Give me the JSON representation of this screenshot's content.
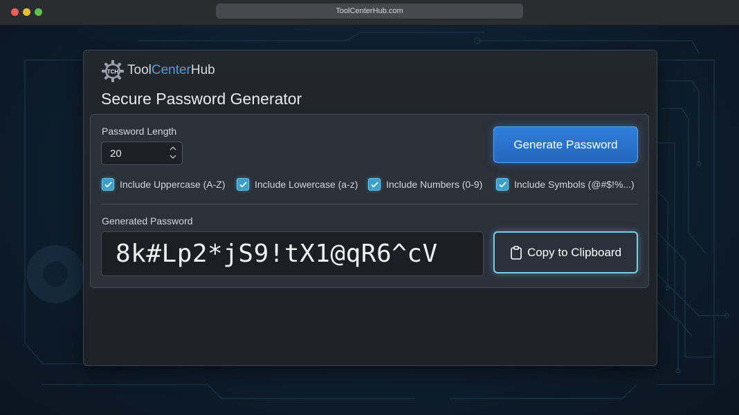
{
  "browser": {
    "url": "ToolCenterHub.com"
  },
  "brand": {
    "logo_text": "TCH",
    "name_part1": "Tool",
    "name_part2": "Center",
    "name_part3": "Hub"
  },
  "page": {
    "title": "Secure Password Generator"
  },
  "settings": {
    "length_label": "Password Length",
    "length_value": "20",
    "generate_label": "Generate Password",
    "options": [
      {
        "label": "Include Uppercase (A-Z)",
        "checked": true
      },
      {
        "label": "Include Lowercase (a-z)",
        "checked": true
      },
      {
        "label": "Include Numbers (0-9)",
        "checked": true
      },
      {
        "label": "Include Symbols (@#$!%...)",
        "checked": true
      }
    ]
  },
  "output": {
    "label": "Generated Password",
    "password": "8k#Lp2*jS9!tX1@qR6^cV",
    "copy_label": "Copy to Clipboard"
  },
  "colors": {
    "accent_blue": "#2f7ed8",
    "checkbox_cyan": "#3b9fc9",
    "brand_center": "#4f9ed6"
  }
}
